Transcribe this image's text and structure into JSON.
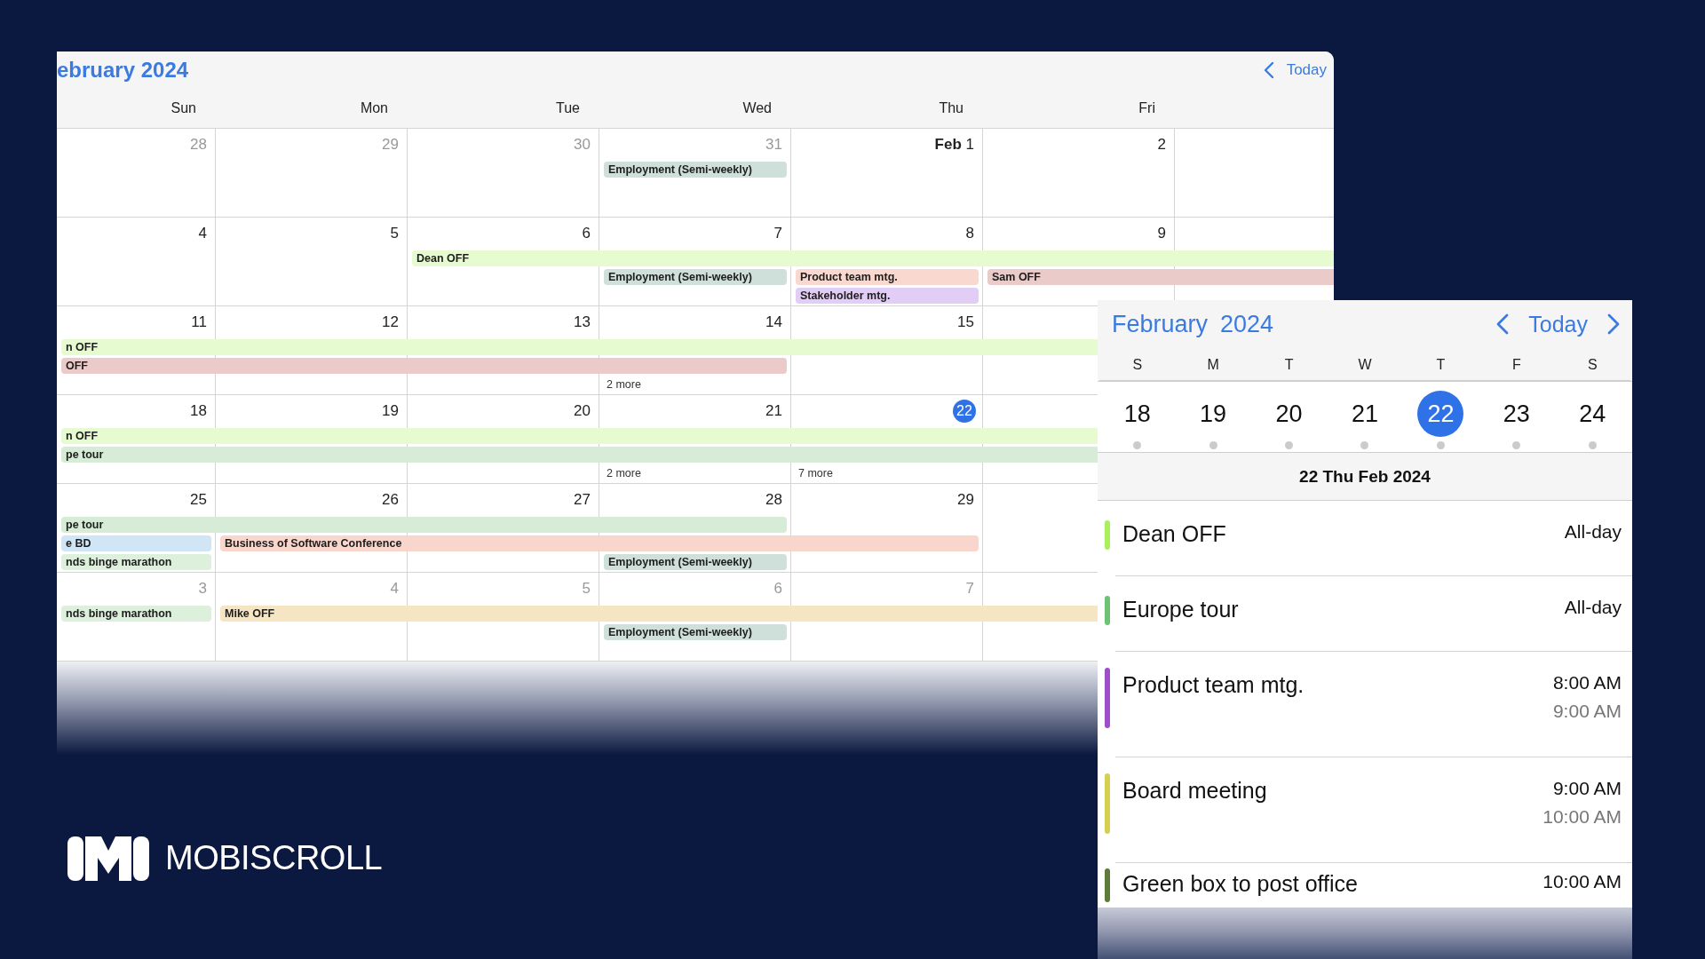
{
  "month_view": {
    "title": "ebruary 2024",
    "today_button": "Today",
    "weekdays": [
      "Sun",
      "Mon",
      "Tue",
      "Wed",
      "Thu",
      "Fri"
    ],
    "weeks": [
      {
        "days": [
          {
            "label": "28",
            "muted": true,
            "today": false
          },
          {
            "label": "29",
            "muted": true,
            "today": false
          },
          {
            "label": "30",
            "muted": true,
            "today": false
          },
          {
            "label": "31",
            "muted": true,
            "today": false
          },
          {
            "label": "**Feb**  1",
            "muted": false,
            "today": false
          },
          {
            "label": "2",
            "muted": false,
            "today": false
          }
        ],
        "lanes": [
          [
            {
              "kind": "empty"
            },
            {
              "kind": "empty"
            },
            {
              "kind": "empty"
            },
            {
              "kind": "event",
              "title": "Employment (Semi-weekly)",
              "color": "#cfe0da"
            }
          ]
        ]
      },
      {
        "days": [
          {
            "label": "4",
            "muted": false,
            "today": false
          },
          {
            "label": "5",
            "muted": false,
            "today": false
          },
          {
            "label": "6",
            "muted": false,
            "today": false
          },
          {
            "label": "7",
            "muted": false,
            "today": false
          },
          {
            "label": "8",
            "muted": false,
            "today": false
          },
          {
            "label": "9",
            "muted": false,
            "today": false
          }
        ],
        "lanes": [
          [
            {
              "kind": "empty"
            },
            {
              "kind": "empty"
            },
            {
              "kind": "event",
              "title": "Dean OFF",
              "color": "#e7fbd1"
            },
            {
              "kind": "continued"
            },
            {
              "kind": "continued"
            },
            {
              "kind": "continued"
            },
            {
              "kind": "continued"
            }
          ],
          [
            {
              "kind": "empty"
            },
            {
              "kind": "empty"
            },
            {
              "kind": "empty"
            },
            {
              "kind": "event",
              "title": "Employment (Semi-weekly)",
              "color": "#cfe0da"
            },
            {
              "kind": "event",
              "title": "Product team mtg.",
              "color": "#f9d9cf"
            },
            {
              "kind": "event",
              "title": "Sam OFF",
              "color": "#ebcaca"
            },
            {
              "kind": "continued"
            }
          ],
          [
            {
              "kind": "empty"
            },
            {
              "kind": "empty"
            },
            {
              "kind": "empty"
            },
            {
              "kind": "empty"
            },
            {
              "kind": "event",
              "title": "Stakeholder mtg.",
              "color": "#e2cdf6"
            }
          ]
        ]
      },
      {
        "days": [
          {
            "label": "11",
            "muted": false,
            "today": false
          },
          {
            "label": "12",
            "muted": false,
            "today": false
          },
          {
            "label": "13",
            "muted": false,
            "today": false
          },
          {
            "label": "14",
            "muted": false,
            "today": false
          },
          {
            "label": "15",
            "muted": false,
            "today": false
          }
        ],
        "lanes": [
          [
            {
              "kind": "event",
              "title": "n OFF",
              "color": "#e7fbd1"
            },
            {
              "kind": "continued"
            },
            {
              "kind": "continued"
            },
            {
              "kind": "continued"
            },
            {
              "kind": "continued"
            },
            {
              "kind": "continued"
            },
            {
              "kind": "continued"
            }
          ],
          [
            {
              "kind": "event",
              "title": "OFF",
              "color": "#ebcaca"
            },
            {
              "kind": "continued"
            },
            {
              "kind": "continued"
            },
            {
              "kind": "continued"
            }
          ],
          [
            {
              "kind": "empty"
            },
            {
              "kind": "empty"
            },
            {
              "kind": "empty"
            },
            {
              "kind": "more",
              "title": "2 more"
            }
          ]
        ]
      },
      {
        "days": [
          {
            "label": "18",
            "muted": false,
            "today": false
          },
          {
            "label": "19",
            "muted": false,
            "today": false
          },
          {
            "label": "20",
            "muted": false,
            "today": false
          },
          {
            "label": "21",
            "muted": false,
            "today": false
          },
          {
            "label": "22",
            "muted": false,
            "today": true
          }
        ],
        "lanes": [
          [
            {
              "kind": "event",
              "title": "n OFF",
              "color": "#e7fbd1"
            },
            {
              "kind": "continued"
            },
            {
              "kind": "continued"
            },
            {
              "kind": "continued"
            },
            {
              "kind": "continued"
            },
            {
              "kind": "continued"
            },
            {
              "kind": "continued"
            }
          ],
          [
            {
              "kind": "event",
              "title": "pe tour",
              "color": "#d6ecd6"
            },
            {
              "kind": "continued"
            },
            {
              "kind": "continued"
            },
            {
              "kind": "continued"
            },
            {
              "kind": "continued"
            },
            {
              "kind": "continued"
            },
            {
              "kind": "continued"
            }
          ],
          [
            {
              "kind": "empty"
            },
            {
              "kind": "empty"
            },
            {
              "kind": "empty"
            },
            {
              "kind": "more",
              "title": "2 more"
            },
            {
              "kind": "more",
              "title": "7 more"
            }
          ]
        ]
      },
      {
        "days": [
          {
            "label": "25",
            "muted": false,
            "today": false
          },
          {
            "label": "26",
            "muted": false,
            "today": false
          },
          {
            "label": "27",
            "muted": false,
            "today": false
          },
          {
            "label": "28",
            "muted": false,
            "today": false
          },
          {
            "label": "29",
            "muted": false,
            "today": false
          }
        ],
        "lanes": [
          [
            {
              "kind": "event",
              "title": "pe tour",
              "color": "#d6ecd6"
            },
            {
              "kind": "continued"
            },
            {
              "kind": "continued"
            },
            {
              "kind": "continued"
            }
          ],
          [
            {
              "kind": "event",
              "title": "e BD",
              "color": "#d0e6f6"
            },
            {
              "kind": "event",
              "title": "Business of Software Conference",
              "color": "#f9d6cc"
            },
            {
              "kind": "continued"
            },
            {
              "kind": "continued"
            },
            {
              "kind": "continued"
            }
          ],
          [
            {
              "kind": "event",
              "title": "nds binge marathon",
              "color": "#dcf0dc"
            },
            {
              "kind": "empty"
            },
            {
              "kind": "empty"
            },
            {
              "kind": "event",
              "title": "Employment (Semi-weekly)",
              "color": "#cfe0da"
            }
          ]
        ]
      },
      {
        "days": [
          {
            "label": "3",
            "muted": true,
            "today": false
          },
          {
            "label": "4",
            "muted": true,
            "today": false
          },
          {
            "label": "5",
            "muted": true,
            "today": false
          },
          {
            "label": "6",
            "muted": true,
            "today": false
          },
          {
            "label": "7",
            "muted": true,
            "today": false
          }
        ],
        "lanes": [
          [
            {
              "kind": "event",
              "title": "nds binge marathon",
              "color": "#dcf0dc"
            },
            {
              "kind": "event",
              "title": "Mike OFF",
              "color": "#f6e5c2"
            },
            {
              "kind": "continued"
            },
            {
              "kind": "continued"
            },
            {
              "kind": "continued"
            },
            {
              "kind": "continued"
            },
            {
              "kind": "continued"
            }
          ],
          [
            {
              "kind": "empty"
            },
            {
              "kind": "empty"
            },
            {
              "kind": "empty"
            },
            {
              "kind": "event",
              "title": "Employment (Semi-weekly)",
              "color": "#cfe0da"
            }
          ]
        ]
      }
    ]
  },
  "agenda": {
    "month": "February",
    "year": "2024",
    "today_button": "Today",
    "weekdays": [
      "S",
      "M",
      "T",
      "W",
      "T",
      "F",
      "S"
    ],
    "dates": [
      {
        "label": "18",
        "selected": false
      },
      {
        "label": "19",
        "selected": false
      },
      {
        "label": "20",
        "selected": false
      },
      {
        "label": "21",
        "selected": false
      },
      {
        "label": "22",
        "selected": true
      },
      {
        "label": "23",
        "selected": false
      },
      {
        "label": "24",
        "selected": false
      }
    ],
    "date_header": "22 Thu Feb 2024",
    "events": [
      {
        "title": "Dean OFF",
        "start": "All-day",
        "color": "#a8f05c"
      },
      {
        "title": "Europe tour",
        "start": "All-day",
        "color": "#6ec273"
      },
      {
        "title": "Product team mtg.",
        "start": "8:00 AM",
        "end": "9:00 AM",
        "color": "#9c4fc9"
      },
      {
        "title": "Board meeting",
        "start": "9:00 AM",
        "end": "10:00 AM",
        "color": "#d5d052"
      },
      {
        "title": "Green box to post office",
        "start": "10:00 AM",
        "color": "#5e7b3b"
      }
    ]
  },
  "brand": {
    "name": "MOBISCROLL"
  }
}
